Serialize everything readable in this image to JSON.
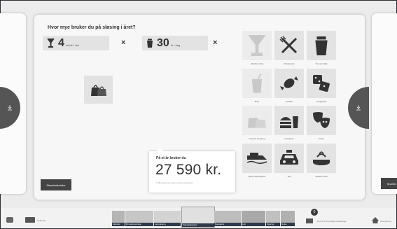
{
  "main": {
    "title": "Hvor mye bruker du på sløsing i året?",
    "inputs": [
      {
        "icon": "cocktail-glass-icon",
        "value": "4",
        "unit": "antall / uke"
      },
      {
        "icon": "coffee-cup-icon",
        "value": "30",
        "unit": "kr / dag"
      }
    ],
    "remove_symbol": "×",
    "categories": [
      {
        "label": "Alkohol enhet",
        "icon": "cocktail-glass-icon"
      },
      {
        "label": "Restaurant",
        "icon": "fork-knife-icon"
      },
      {
        "label": "Ta med kaffe",
        "icon": "coffee-cup-icon"
      },
      {
        "label": "Brus",
        "icon": "soda-cup-icon"
      },
      {
        "label": "Godteri",
        "icon": "candy-icon"
      },
      {
        "label": "Pengespill",
        "icon": "dice-icon"
      },
      {
        "label": "Impulsiv shopping",
        "icon": "shopping-bags-icon"
      },
      {
        "label": "Hurtigmat",
        "icon": "fast-food-icon"
      },
      {
        "label": "Kultur",
        "icon": "theater-masks-icon"
      },
      {
        "label": "Sjølvmedbringakst",
        "icon": "ferry-icon"
      },
      {
        "label": "Taxi",
        "icon": "taxi-icon"
      },
      {
        "label": "Tobakk enhet",
        "icon": "snus-tobacco-icon"
      }
    ],
    "result": {
      "label": "På et år bruker du",
      "amount": "27 590 kr.",
      "note": "* Alle priserne er kun ment et eksempel"
    },
    "calculator_button": "Sløsekalkulator"
  },
  "right_card": {
    "button": "Sparek"
  },
  "taskbar": {
    "app_label": "Nettbank",
    "thumbnails": [
      "Aktivitet",
      "Din økonomiske",
      "Lønnskonto",
      "Sløsekalkulator",
      "Budsjettet",
      "Lån",
      "Sparing",
      "Reise"
    ],
    "badge": "0",
    "notice": "Du har 0 fremtidige utbetalinger",
    "home_label": "Hovedmeny"
  }
}
